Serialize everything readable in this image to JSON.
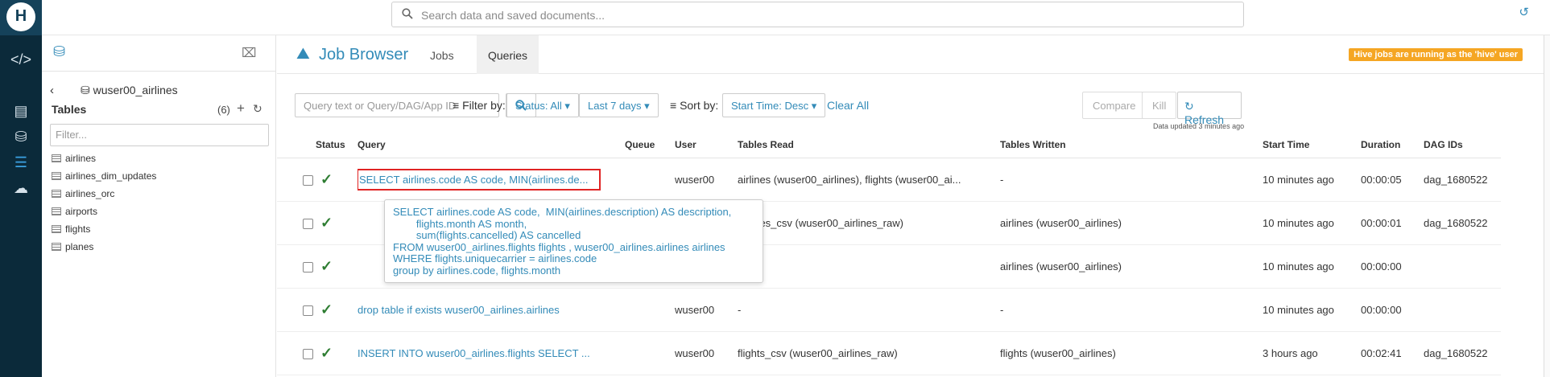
{
  "app": {
    "logo_letter": "H"
  },
  "topbar": {
    "search_placeholder": "Search data and saved documents..."
  },
  "rail": {
    "items": [
      "editor-icon",
      "documents-icon",
      "database-icon",
      "jobs-icon",
      "upload-icon"
    ]
  },
  "assist": {
    "database": "wuser00_airlines",
    "tables_heading": "Tables",
    "table_count": "(6)",
    "filter_placeholder": "Filter...",
    "tables": [
      "airlines",
      "airlines_dim_updates",
      "airlines_orc",
      "airports",
      "flights",
      "planes"
    ]
  },
  "header": {
    "title": "Job Browser",
    "tabs": [
      {
        "label": "Jobs"
      },
      {
        "label": "Queries"
      }
    ],
    "badge": "Hive jobs are running as the 'hive' user"
  },
  "toolbar": {
    "query_placeholder": "Query text or Query/DAG/App ID",
    "filter_label": "Filter by:",
    "status_filter": "Status: All",
    "date_filter": "Last 7 days",
    "sort_label": "Sort by:",
    "sort_value": "Start Time: Desc",
    "clear_all": "Clear All",
    "compare": "Compare",
    "kill": "Kill",
    "refresh": "Refresh",
    "updated": "Data updated 3 minutes ago"
  },
  "table": {
    "columns": [
      "Status",
      "Query",
      "Queue",
      "User",
      "Tables Read",
      "Tables Written",
      "Start Time",
      "Duration",
      "DAG IDs"
    ],
    "rows": [
      {
        "status": "success",
        "query": "SELECT airlines.code AS code, MIN(airlines.de...",
        "queue": "",
        "user": "wuser00",
        "tables_read": "airlines (wuser00_airlines), flights (wuser00_ai...",
        "tables_written": "-",
        "start_time": "10 minutes ago",
        "duration": "00:00:05",
        "dag": "dag_1680522"
      },
      {
        "status": "success",
        "query": "",
        "queue": "",
        "user": "",
        "tables_read": "airlines_csv (wuser00_airlines_raw)",
        "tables_written": "airlines (wuser00_airlines)",
        "start_time": "10 minutes ago",
        "duration": "00:00:01",
        "dag": "dag_1680522"
      },
      {
        "status": "success",
        "query": "",
        "queue": "",
        "user": "",
        "tables_read": "",
        "tables_written": "airlines (wuser00_airlines)",
        "start_time": "10 minutes ago",
        "duration": "00:00:00",
        "dag": ""
      },
      {
        "status": "success",
        "query": "drop table if exists wuser00_airlines.airlines",
        "queue": "",
        "user": "wuser00",
        "tables_read": "-",
        "tables_written": "-",
        "start_time": "10 minutes ago",
        "duration": "00:00:00",
        "dag": ""
      },
      {
        "status": "success",
        "query": "INSERT INTO wuser00_airlines.flights SELECT ...",
        "queue": "",
        "user": "wuser00",
        "tables_read": "flights_csv (wuser00_airlines_raw)",
        "tables_written": "flights (wuser00_airlines)",
        "start_time": "3 hours ago",
        "duration": "00:02:41",
        "dag": "dag_1680522"
      }
    ]
  },
  "tooltip": {
    "lines": [
      "SELECT airlines.code AS code,  MIN(airlines.description) AS description,",
      "        flights.month AS month,",
      "        sum(flights.cancelled) AS cancelled",
      "FROM wuser00_airlines.flights flights , wuser00_airlines.airlines airlines",
      "WHERE flights.uniquecarrier = airlines.code",
      "group by airlines.code, flights.month"
    ]
  }
}
